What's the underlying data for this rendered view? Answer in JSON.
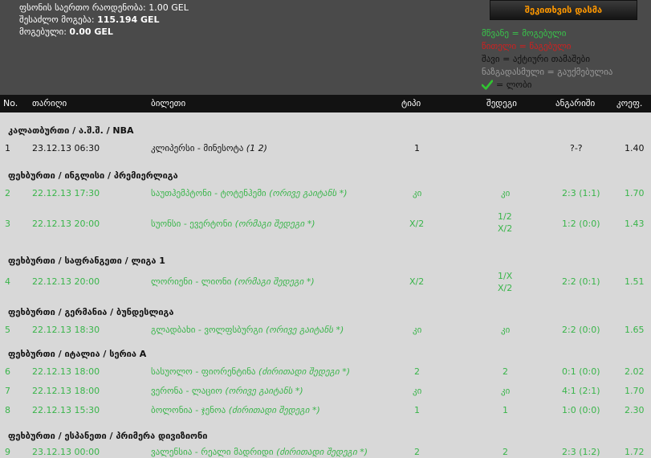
{
  "header": {
    "total_stake_label": "ფსონის საერთო რაოდენობა:",
    "total_stake_value": "1.00 GEL",
    "possible_win_label": "შესაძლო მოგება:",
    "possible_win_value": "115.194 GEL",
    "won_label": "მოგებული:",
    "won_value": "0.00 GEL",
    "print_button": "შეკითხვის დასმა"
  },
  "legend": {
    "green": "მწვანე = მოგებული",
    "red": "წითელი = წაგებული",
    "black": "შავი = აქტიური თამაშები",
    "gray": "ნაზგადასმული = გაუქმებულია",
    "lobby": "= ლობი",
    "colors": {
      "green": "#38c64a",
      "red": "#cf2020",
      "black": "#111111",
      "gray": "#9a9a9a"
    }
  },
  "table": {
    "headers": {
      "no": "No.",
      "date": "თარიღი",
      "ticket": "ბილეთი",
      "type": "ტიპი",
      "result": "შედეგი",
      "score": "ანგარიში",
      "odds": "კოეფ."
    },
    "groups": [
      {
        "title": "კალათბურთი / ა.შ.შ. / NBA",
        "rows": [
          {
            "no": "1",
            "date": "23.12.13 06:30",
            "match": "კლიპერსი - მინესოტა",
            "note": "(1 2)",
            "type": "1",
            "result": "",
            "score": "?-?",
            "odds": "1.40",
            "status": "active"
          }
        ]
      },
      {
        "title": "ფეხბურთი / ინგლისი / პრემიერლიგა",
        "rows": [
          {
            "no": "2",
            "date": "22.12.13 17:30",
            "match": "საუთჰემპტონი - ტოტენჰემი",
            "note": "(ორივე გაიტანს *)",
            "type": "კი",
            "result": "კი",
            "score": "2:3 (1:1)",
            "odds": "1.70",
            "status": "won"
          },
          {
            "no": "3",
            "date": "22.12.13 20:00",
            "match": "სუონსი - ევერტონი",
            "note": "(ორმაგი შედეგი *)",
            "type": "X/2",
            "result": "1/2\nX/2",
            "score": "1:2 (0:0)",
            "odds": "1.43",
            "status": "won"
          }
        ]
      },
      {
        "title": "ფეხბურთი / საფრანგეთი / ლიგა 1",
        "rows": [
          {
            "no": "4",
            "date": "22.12.13 20:00",
            "match": "ლორიენი - ლიონი",
            "note": "(ორმაგი შედეგი *)",
            "type": "X/2",
            "result": "1/X\nX/2",
            "score": "2:2 (0:1)",
            "odds": "1.51",
            "status": "won"
          }
        ]
      },
      {
        "title": "ფეხბურთი / გერმანია / ბუნდესლიგა",
        "rows": [
          {
            "no": "5",
            "date": "22.12.13 18:30",
            "match": "გლადბახი - ვოლფსბურგი",
            "note": "(ორივე გაიტანს *)",
            "type": "კი",
            "result": "კი",
            "score": "2:2 (0:0)",
            "odds": "1.65",
            "status": "won"
          }
        ]
      },
      {
        "title": "ფეხბურთი / იტალია / სერია A",
        "rows": [
          {
            "no": "6",
            "date": "22.12.13 18:00",
            "match": "სასუოლო - ფიორენტინა",
            "note": "(ძირითადი შედეგი *)",
            "type": "2",
            "result": "2",
            "score": "0:1 (0:0)",
            "odds": "2.02",
            "status": "won"
          },
          {
            "no": "7",
            "date": "22.12.13 18:00",
            "match": "ვერონა - ლაციო",
            "note": "(ორივე გაიტანს *)",
            "type": "კი",
            "result": "კი",
            "score": "4:1 (2:1)",
            "odds": "1.70",
            "status": "won"
          },
          {
            "no": "8",
            "date": "22.12.13 15:30",
            "match": "ბოლონია - ჯენოა",
            "note": "(ძირითადი შედეგი *)",
            "type": "1",
            "result": "1",
            "score": "1:0 (0:0)",
            "odds": "2.30",
            "status": "won"
          }
        ]
      },
      {
        "title": "ფეხბურთი / ესპანეთი / პრიმერა დივიზიონი",
        "rows": [
          {
            "no": "9",
            "date": "23.12.13 00:00",
            "match": "ვალენსია - რეალი მადრიდი",
            "note": "(ძირითადი შედეგი *)",
            "type": "2",
            "result": "2",
            "score": "2:3 (1:2)",
            "odds": "1.72",
            "status": "won"
          }
        ]
      }
    ]
  }
}
